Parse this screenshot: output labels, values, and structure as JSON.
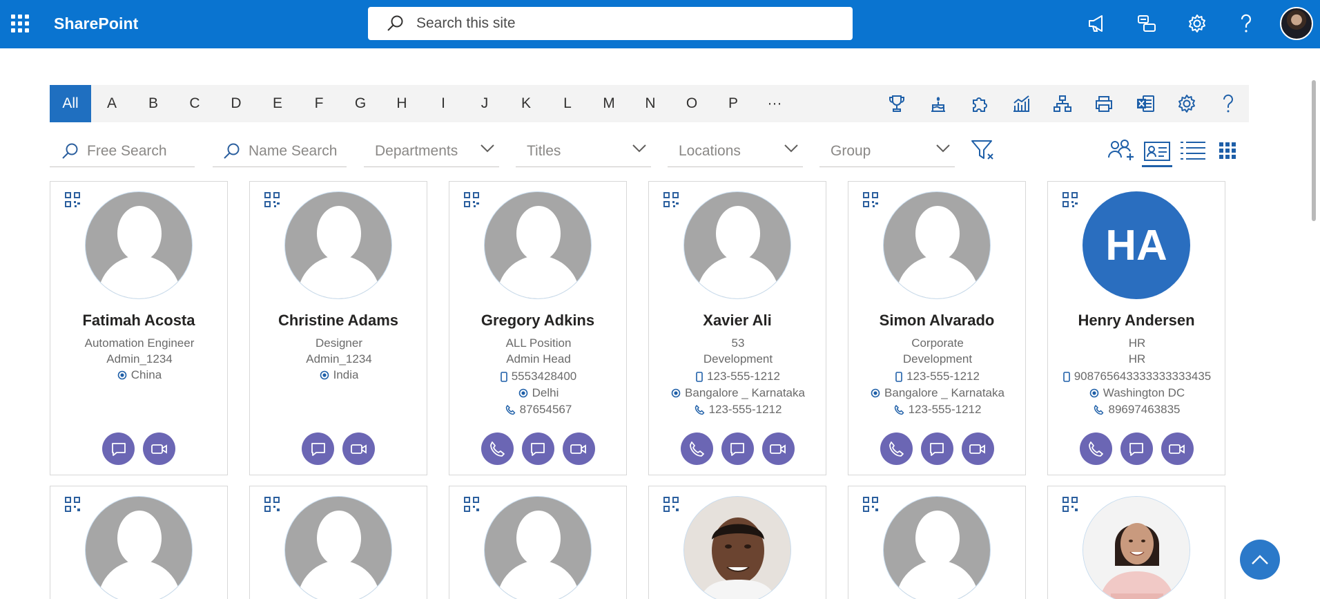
{
  "app": {
    "title": "SharePoint"
  },
  "search": {
    "placeholder": "Search this site"
  },
  "alphabet": [
    "All",
    "A",
    "B",
    "C",
    "D",
    "E",
    "F",
    "G",
    "H",
    "I",
    "J",
    "K",
    "L",
    "M",
    "N",
    "O",
    "P",
    "···"
  ],
  "filters": {
    "free_search": "Free Search",
    "name_search": "Name Search",
    "departments": "Departments",
    "titles": "Titles",
    "locations": "Locations",
    "group": "Group"
  },
  "cards": [
    {
      "name": "Fatimah Acosta",
      "line1": "Automation Engineer",
      "line2": "Admin_1234",
      "location": "China"
    },
    {
      "name": "Christine Adams",
      "line1": "Designer",
      "line2": "Admin_1234",
      "location": "India"
    },
    {
      "name": "Gregory Adkins",
      "line1": "ALL Position",
      "line2": "Admin Head",
      "mobile": "5553428400",
      "location": "Delhi",
      "phone": "87654567"
    },
    {
      "name": "Xavier Ali",
      "line1": "53",
      "line2": "Development",
      "mobile": "123-555-1212",
      "location": "Bangalore _ Karnataka",
      "phone": "123-555-1212"
    },
    {
      "name": "Simon Alvarado",
      "line1": "Corporate",
      "line2": "Development",
      "mobile": "123-555-1212",
      "location": "Bangalore _ Karnataka",
      "phone": "123-555-1212"
    },
    {
      "name": "Henry Andersen",
      "initials": "HA",
      "line1": "HR",
      "line2": "HR",
      "mobile": "908765643333333333435",
      "location": "Washington DC",
      "phone": "89697463835"
    }
  ],
  "colors": {
    "brand": "#0a74d0",
    "action": "#6b66b4",
    "active_letter": "#1f6fc0"
  }
}
